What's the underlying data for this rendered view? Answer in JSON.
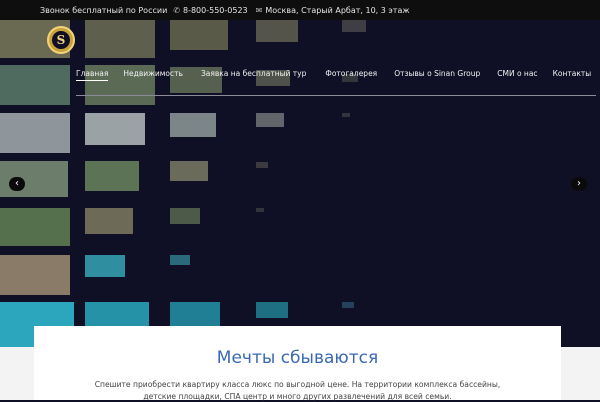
{
  "topbar": {
    "free_call": "Звонок бесплатный по России",
    "phone": "8-800-550-0523",
    "address": "Москва, Старый Арбат, 10, 3 этаж"
  },
  "logo": {
    "letter": "S"
  },
  "nav": {
    "items": [
      {
        "label": "Главная"
      },
      {
        "label": "Недвижимость"
      },
      {
        "label": "Заявка на бесплатный тур"
      },
      {
        "label": "Фотогалерея"
      },
      {
        "label": "Отзывы о Sinan Group"
      },
      {
        "label": "СМИ о нас"
      },
      {
        "label": "Контакты"
      }
    ]
  },
  "slider": {
    "prev_glyph": "‹",
    "next_glyph": "›"
  },
  "hero_text": {
    "title": "Мечты сбываются",
    "line1": "Спешите приобрести квартиру класса люкс по выгодной цене. На территории комплекса бассейны,",
    "line2": "детские площадки, СПА центр и много других развлечений для всей семьи."
  },
  "colors": {
    "accent": "#3a68b2",
    "hero_bg": "#0f0f26"
  }
}
